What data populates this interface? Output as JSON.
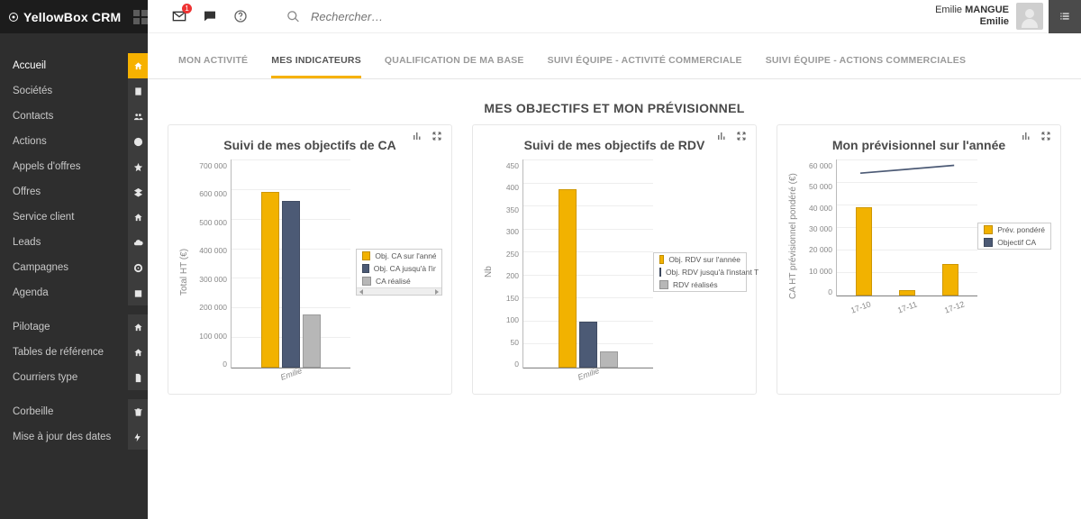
{
  "brand": "YellowBox CRM",
  "search": {
    "placeholder": "Rechercher…"
  },
  "notif_badge": "1",
  "user": {
    "line1_pre": "Emilie ",
    "line1_bold": "MANGUE",
    "line2": "Emilie"
  },
  "sidebar": {
    "items": [
      {
        "label": "Accueil",
        "icon": "home",
        "active": true
      },
      {
        "label": "Sociétés",
        "icon": "building"
      },
      {
        "label": "Contacts",
        "icon": "users"
      },
      {
        "label": "Actions",
        "icon": "clock"
      },
      {
        "label": "Appels d'offres",
        "icon": "star"
      },
      {
        "label": "Offres",
        "icon": "layers"
      },
      {
        "label": "Service client",
        "icon": "home"
      },
      {
        "label": "Leads",
        "icon": "cloud"
      },
      {
        "label": "Campagnes",
        "icon": "target"
      },
      {
        "label": "Agenda",
        "icon": "calendar"
      }
    ],
    "items2": [
      {
        "label": "Pilotage",
        "icon": "home"
      },
      {
        "label": "Tables de référence",
        "icon": "home"
      },
      {
        "label": "Courriers type",
        "icon": "file"
      }
    ],
    "items3": [
      {
        "label": "Corbeille",
        "icon": "trash"
      },
      {
        "label": "Mise à jour des dates",
        "icon": "bolt"
      }
    ]
  },
  "tabs": [
    {
      "label": "MON ACTIVITÉ"
    },
    {
      "label": "MES INDICATEURS",
      "active": true
    },
    {
      "label": "QUALIFICATION DE MA BASE"
    },
    {
      "label": "SUIVI ÉQUIPE - ACTIVITÉ COMMERCIALE"
    },
    {
      "label": "SUIVI ÉQUIPE - ACTIONS COMMERCIALES"
    }
  ],
  "section_title": "MES OBJECTIFS ET MON PRÉVISIONNEL",
  "cards": {
    "ca": {
      "title": "Suivi de mes objectifs de CA",
      "ylabel": "Total HT (€)",
      "xcat": "Emilie",
      "legend": [
        "Obj. CA sur l'année",
        "Obj. CA jusqu'à l'instant T",
        "CA réalisé"
      ]
    },
    "rdv": {
      "title": "Suivi de mes objectifs de RDV",
      "ylabel": "Nb",
      "xcat": "Emilie",
      "legend": [
        "Obj. RDV sur l'année",
        "Obj. RDV jusqu'à l'instant T",
        "RDV réalisés"
      ]
    },
    "prev": {
      "title": "Mon prévisionnel sur l'année",
      "ylabel": "CA HT prévisionnel pondéré (€)",
      "legend": [
        "Prév. pondéré",
        "Objectif CA"
      ]
    }
  },
  "chart_data": [
    {
      "type": "bar",
      "title": "Suivi de mes objectifs de CA",
      "categories": [
        "Emilie"
      ],
      "series": [
        {
          "name": "Obj. CA sur l'année",
          "values": [
            590000
          ],
          "color": "#f2b200"
        },
        {
          "name": "Obj. CA jusqu'à l'instant T",
          "values": [
            560000
          ],
          "color": "#4c5a75"
        },
        {
          "name": "CA réalisé",
          "values": [
            180000
          ],
          "color": "#b7b7b7"
        }
      ],
      "ylabel": "Total HT (€)",
      "ylim": [
        0,
        700000
      ],
      "ytick": 100000
    },
    {
      "type": "bar",
      "title": "Suivi de mes objectifs de RDV",
      "categories": [
        "Emilie"
      ],
      "series": [
        {
          "name": "Obj. RDV sur l'année",
          "values": [
            385
          ],
          "color": "#f2b200"
        },
        {
          "name": "Obj. RDV jusqu'à l'instant T",
          "values": [
            100
          ],
          "color": "#4c5a75"
        },
        {
          "name": "RDV réalisés",
          "values": [
            35
          ],
          "color": "#b7b7b7"
        }
      ],
      "ylabel": "Nb",
      "ylim": [
        0,
        450
      ],
      "ytick": 50
    },
    {
      "type": "bar+line",
      "title": "Mon prévisionnel sur l'année",
      "categories": [
        "17-10",
        "17-11",
        "17-12"
      ],
      "series": [
        {
          "name": "Prév. pondéré",
          "kind": "bar",
          "values": [
            39000,
            2500,
            14000
          ],
          "color": "#f2b200"
        },
        {
          "name": "Objectif CA",
          "kind": "line",
          "values": [
            53000,
            55000,
            57000
          ],
          "color": "#4c5a75"
        }
      ],
      "ylabel": "CA HT prévisionnel pondéré (€)",
      "ylim": [
        0,
        60000
      ],
      "ytick": 10000
    }
  ]
}
